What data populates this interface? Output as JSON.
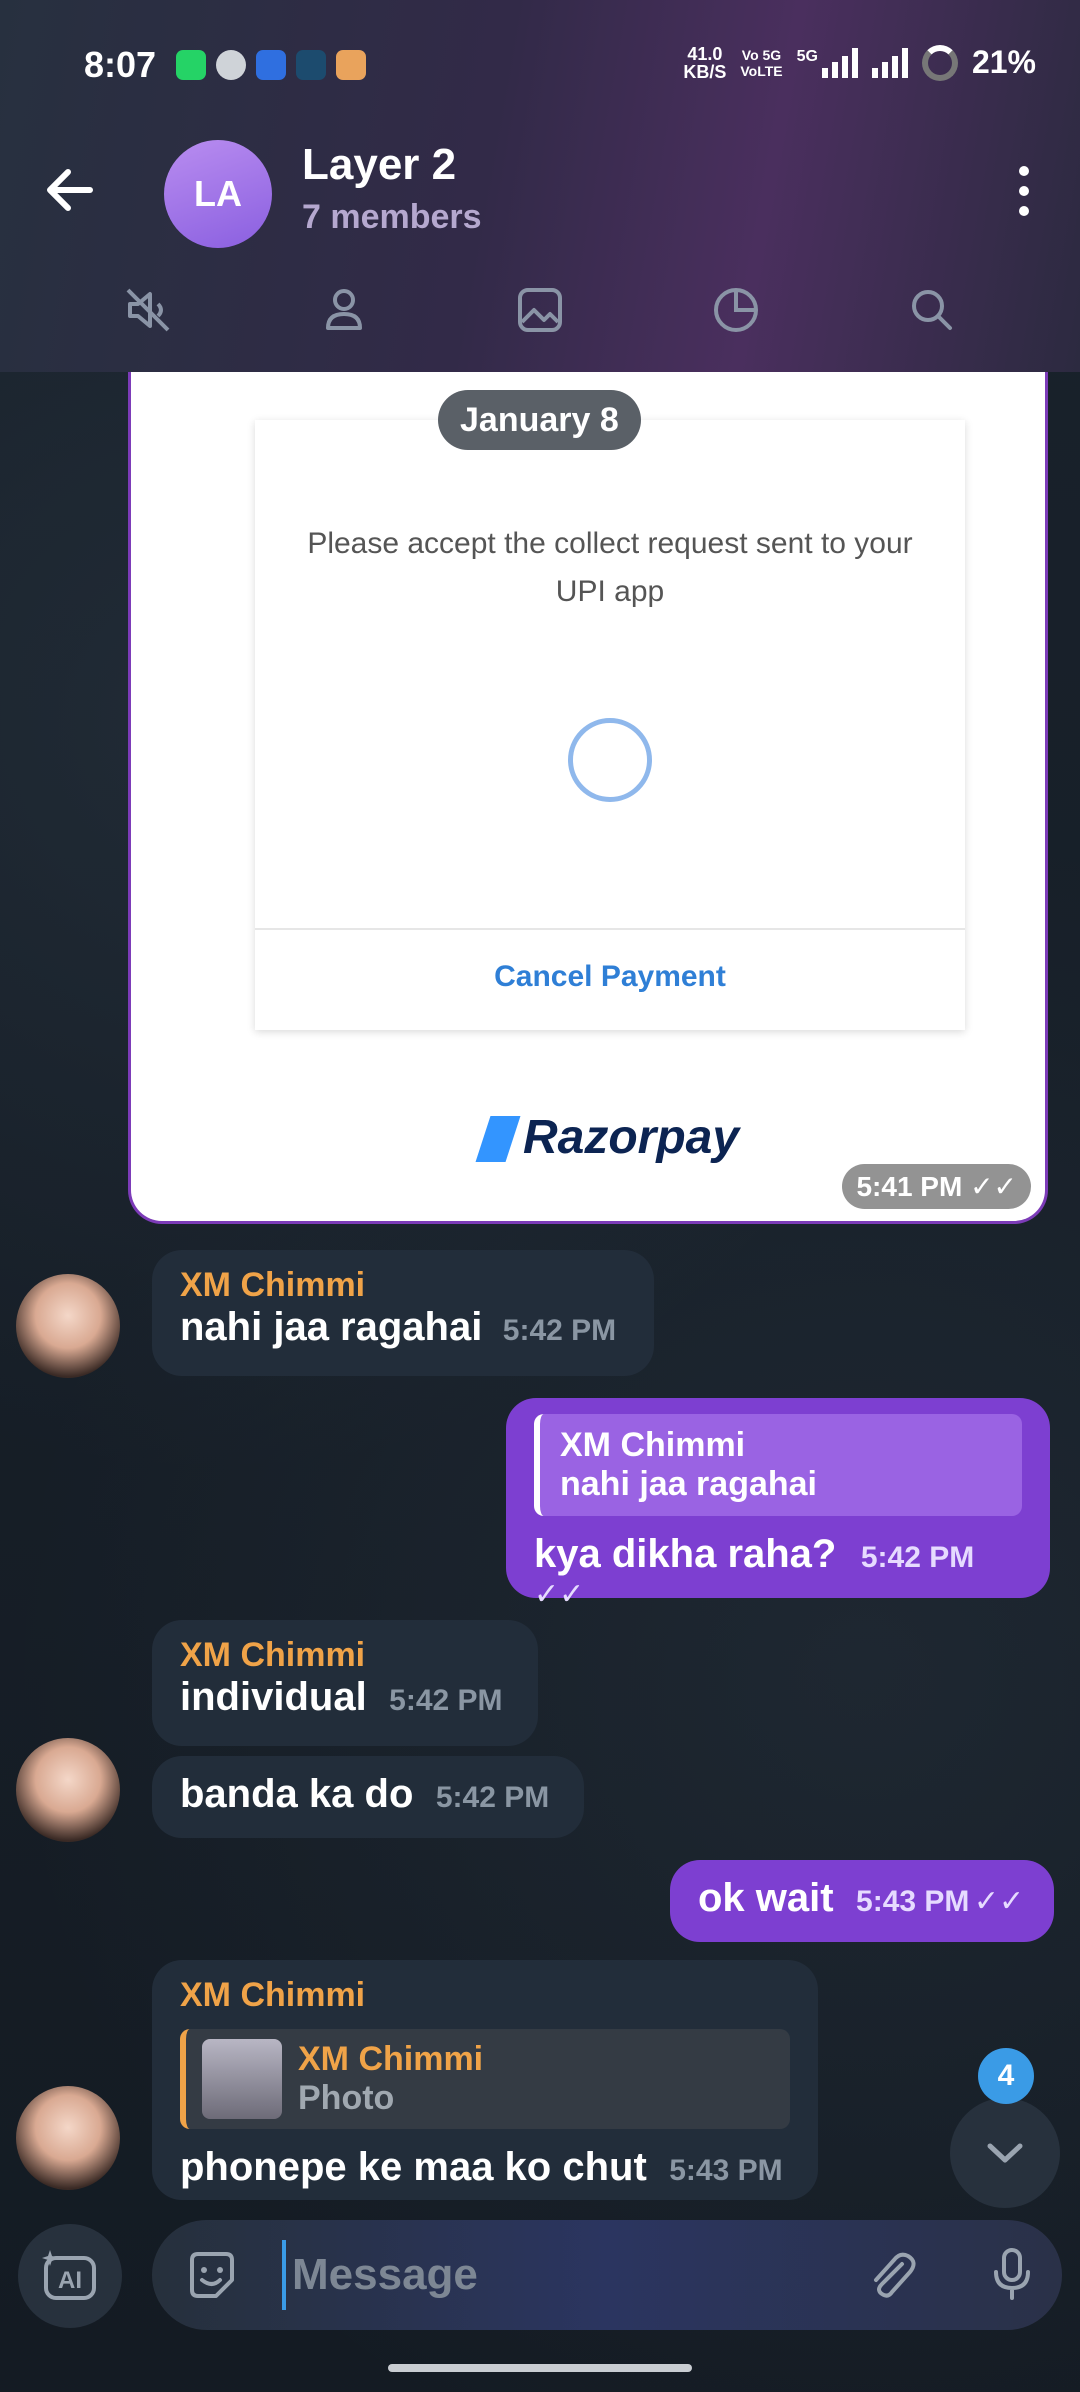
{
  "status_bar": {
    "time": "8:07",
    "net_speed_value": "41.0",
    "net_speed_unit": "KB/S",
    "volte_top": "Vo 5G",
    "volte_bottom": "VoLTE",
    "network": "5G",
    "battery": "21%"
  },
  "header": {
    "avatar_initials": "LA",
    "title": "Layer 2",
    "subtitle": "7 members"
  },
  "date_separator": "January 8",
  "payment_screenshot": {
    "message": "Please accept the collect request sent to your UPI app",
    "cancel_label": "Cancel Payment",
    "brand": "Razorpay",
    "time": "5:41 PM"
  },
  "messages": [
    {
      "sender": "XM Chimmi",
      "text": "nahi jaa ragahai",
      "time": "5:42 PM"
    },
    {
      "reply_name": "XM Chimmi",
      "reply_text": "nahi jaa ragahai",
      "text": "kya dikha raha?",
      "time": "5:42 PM"
    },
    {
      "sender": "XM Chimmi",
      "text": "individual",
      "time": "5:42 PM"
    },
    {
      "text": "banda ka do",
      "time": "5:42 PM"
    },
    {
      "text": "ok wait",
      "time": "5:43 PM"
    },
    {
      "sender": "XM Chimmi",
      "reply_name": "XM Chimmi",
      "reply_text": "Photo",
      "text": "phonepe ke maa ko chut",
      "time": "5:43 PM"
    }
  ],
  "scroll": {
    "unread_count": "4"
  },
  "composer": {
    "placeholder": "Message",
    "ai_label": "AI"
  },
  "colors": {
    "accent": "#7d3fd1",
    "sender_name": "#f0a348",
    "link": "#2f7fd6"
  }
}
